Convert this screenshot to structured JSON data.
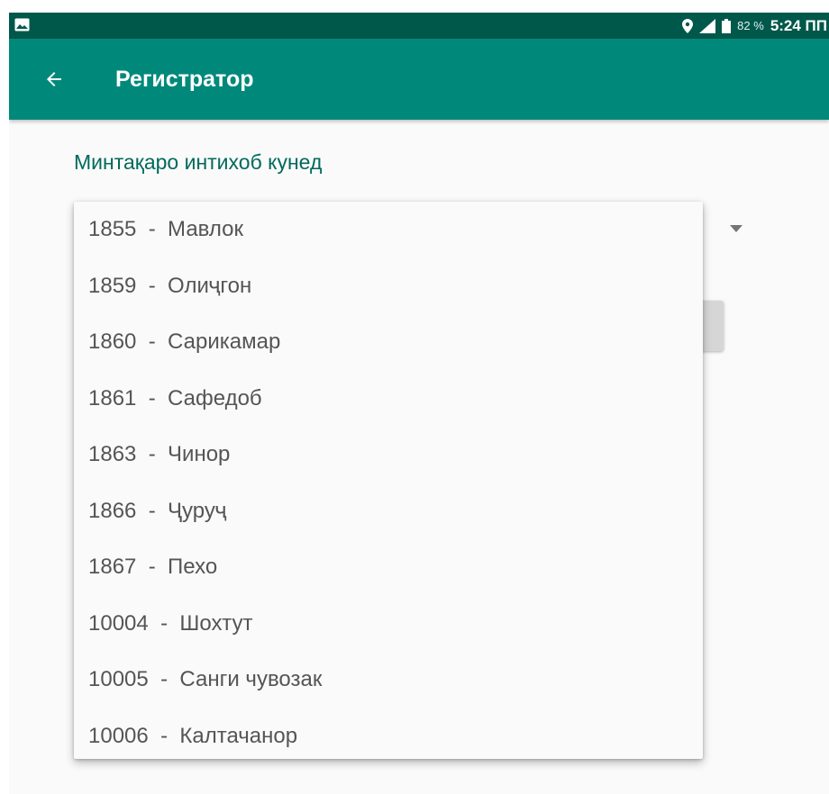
{
  "status_bar": {
    "battery_percent": "82 %",
    "time": "5:24 ПП",
    "icons": [
      "image-icon",
      "location-icon",
      "signal-icon",
      "battery-icon"
    ]
  },
  "app_bar": {
    "title": "Регистратор",
    "back_icon": "arrow-left-icon"
  },
  "form": {
    "prompt": "Минтақаро интихоб кунед"
  },
  "dropdown": {
    "items": [
      {
        "label": "1855  -  Мавлок"
      },
      {
        "label": "1859  -  Олиҷгон"
      },
      {
        "label": "1860  -  Сарикамар"
      },
      {
        "label": "1861  -  Сафедоб"
      },
      {
        "label": "1863  -  Чинор"
      },
      {
        "label": "1866  -  Ҷуруҷ"
      },
      {
        "label": "1867  -  Пехо"
      },
      {
        "label": "10004  -  Шохтут"
      },
      {
        "label": "10005  -  Санги чувозак"
      },
      {
        "label": "10006  -  Калтачанор"
      }
    ]
  },
  "colors": {
    "status_bar": "#00584b",
    "app_bar": "#00897b",
    "accent_text": "#00695c"
  }
}
